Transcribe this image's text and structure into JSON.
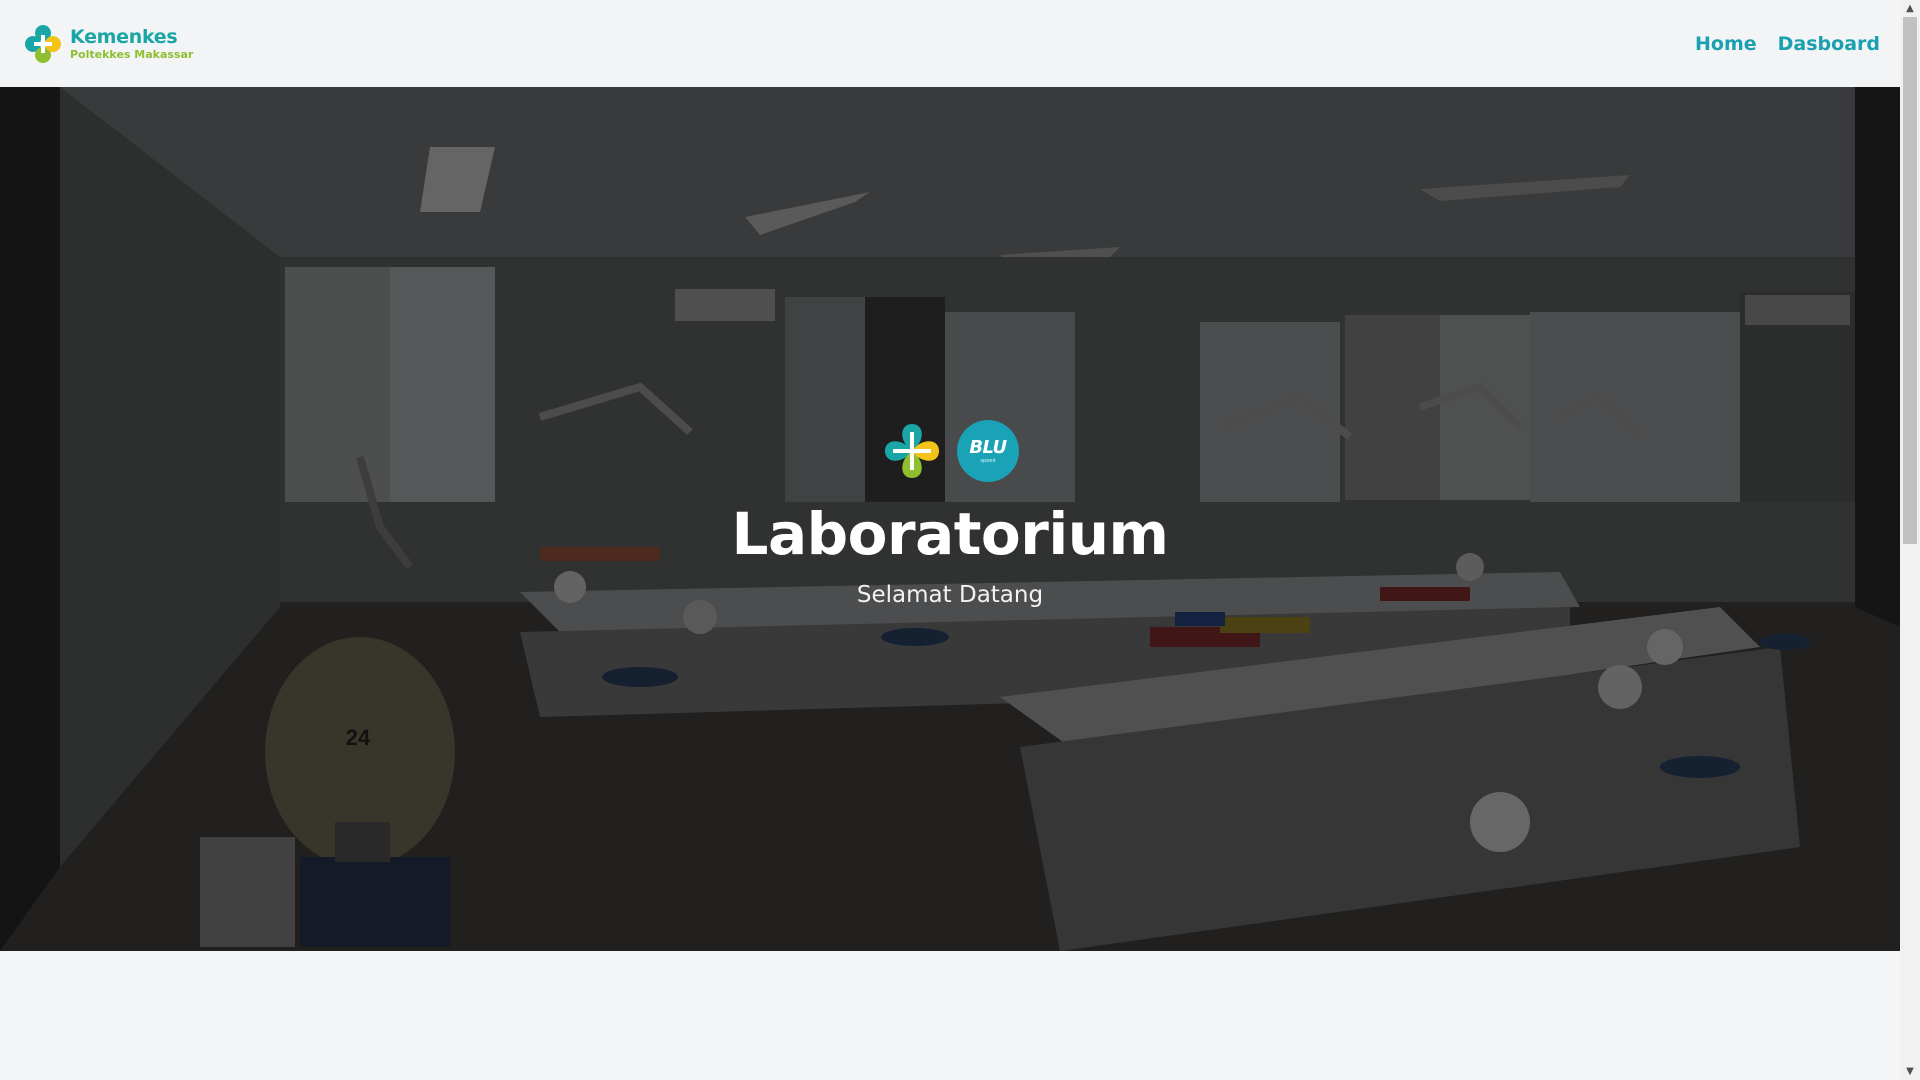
{
  "header": {
    "brand_title": "Kemenkes",
    "brand_subtitle": "Poltekkes Makassar",
    "nav": [
      {
        "label": "Home"
      },
      {
        "label": "Dasboard"
      }
    ]
  },
  "hero": {
    "blu_logo_text": "BLU",
    "blu_logo_subtext": "speed",
    "title": "Laboratorium",
    "subtitle": "Selamat Datang",
    "chair_number": "24"
  },
  "colors": {
    "brand_teal": "#1aa6a6",
    "brand_green": "#8dbf2f",
    "nav_link": "#1aa0b0",
    "page_bg": "#f4f5f7"
  }
}
